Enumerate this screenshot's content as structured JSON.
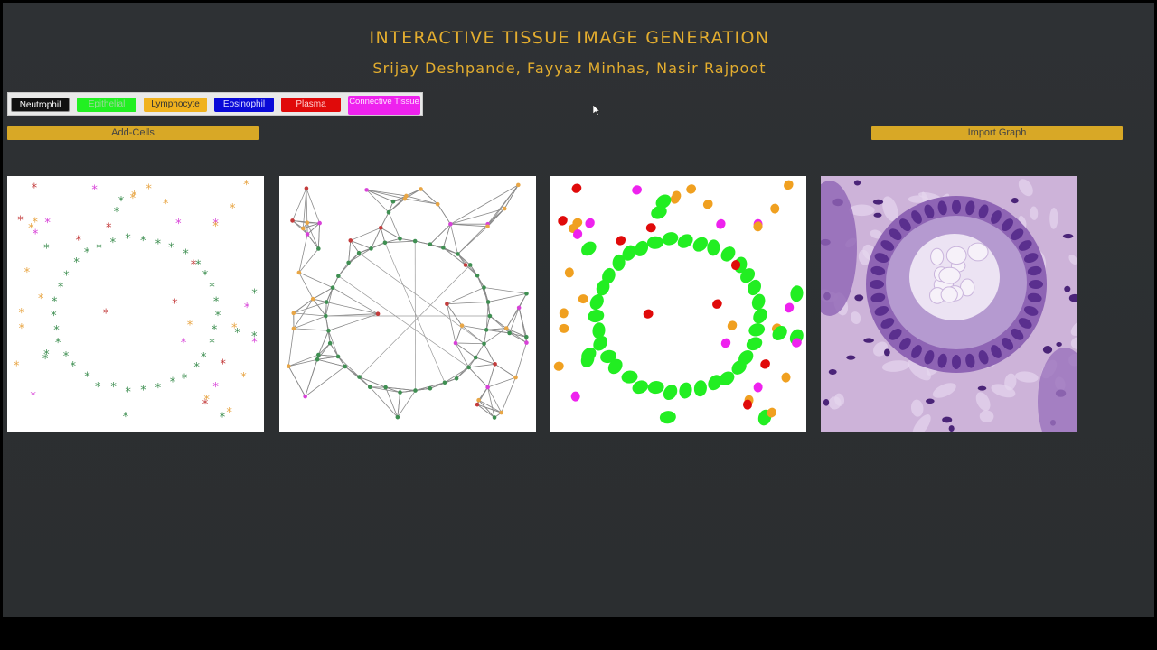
{
  "app": {
    "title": "INTERACTIVE TISSUE IMAGE GENERATION",
    "authors": "Srijay Deshpande, Fayyaz Minhas, Nasir Rajpoot"
  },
  "legend": {
    "items": [
      {
        "label": "Neutrophil",
        "bg": "#111111",
        "fg": "#ffffff"
      },
      {
        "label": "Epithelial",
        "bg": "#22f022",
        "fg": "#9ad89a"
      },
      {
        "label": "Lymphocyte",
        "bg": "#f0b21e",
        "fg": "#333333"
      },
      {
        "label": "Eosinophil",
        "bg": "#0a0ad8",
        "fg": "#e0e0ff"
      },
      {
        "label": "Plasma",
        "bg": "#e00a0a",
        "fg": "#ffd0d0"
      },
      {
        "label": "Connective Tissue",
        "bg": "#ee22ee",
        "fg": "#ffe0ff"
      }
    ]
  },
  "buttons": {
    "add_cells": "Add-Cells",
    "import_graph": "Import Graph"
  },
  "colors": {
    "accent": "#e3ad2f",
    "button": "#d8a826",
    "epithelial_star": "#3f8f52",
    "connective_star": "#d842d8",
    "lymphocyte_star": "#e8a646",
    "plasma_star": "#c33b3b"
  },
  "panels": [
    {
      "name": "cell-star-layout"
    },
    {
      "name": "delaunay-graph"
    },
    {
      "name": "cell-mask"
    },
    {
      "name": "generated-tissue-image"
    }
  ]
}
